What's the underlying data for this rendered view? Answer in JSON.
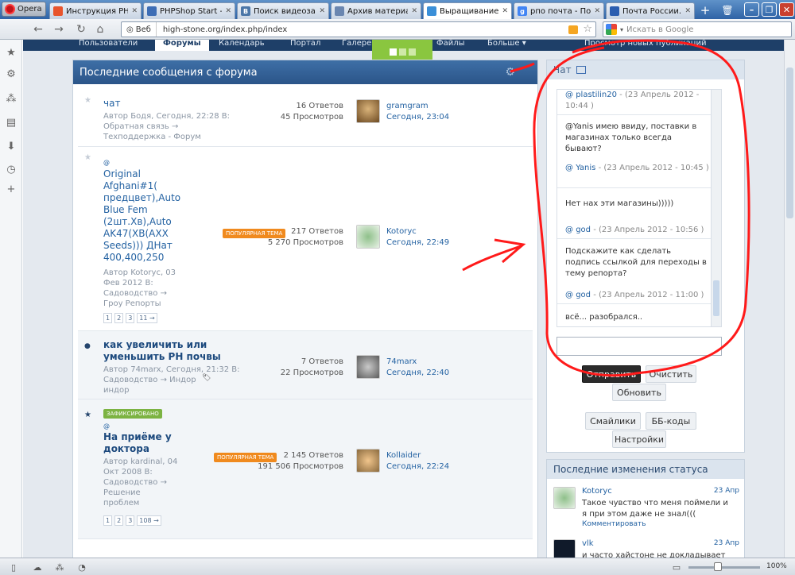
{
  "browser": {
    "menu_label": "Opera",
    "tabs": [
      {
        "label": "Инструкция PH...",
        "favicon": "opera-icon",
        "color": "#e8542c",
        "active": false
      },
      {
        "label": "PHPShop Start -...",
        "favicon": "phpshop-icon",
        "color": "#3d6db5",
        "active": false
      },
      {
        "label": "Поиск видеоза...",
        "favicon": "vk-icon",
        "color": "#4a76a8",
        "active": false
      },
      {
        "label": "Архив материа...",
        "favicon": "site-icon",
        "color": "#6a86b0",
        "active": false
      },
      {
        "label": "Выращивание к...",
        "favicon": "site-icon",
        "color": "#3a8fd8",
        "active": true
      },
      {
        "label": "рпо почта - Пои...",
        "favicon": "google-icon",
        "color": "#4285f4",
        "active": false
      },
      {
        "label": "Почта России. ...",
        "favicon": "mail-icon",
        "color": "#2a5db0",
        "active": false
      }
    ],
    "address": {
      "badge": "Веб",
      "url": "high-stone.org/index.php/index"
    },
    "search": {
      "placeholder": "Искать в Google"
    },
    "zoom": "100%"
  },
  "site_nav": {
    "items": [
      "Пользователи",
      "Форумы",
      "Календарь",
      "Портал",
      "Галерея",
      "Файлы",
      "Больше ▾",
      "Просмотр новых публикаций"
    ],
    "active": "Форумы"
  },
  "forum": {
    "title": "Последние сообщения с форума",
    "topics": [
      {
        "title": "чат",
        "meta": [
          "Автор Бодя, Сегодня, 22:28 В:",
          "Обратная связь →",
          "Техподдержка - Форум"
        ],
        "badge": "",
        "pages": [],
        "replies": "16 Ответов",
        "views": "45 Просмотров",
        "last_user": "gramgram",
        "last_time": "Сегодня, 23:04"
      },
      {
        "title": "Original Afghani#1(предцвет),Auto Blue Fem (2шт.Xв),Auto AK47(XB(AXX Seeds))) ДНат 400,400,250",
        "title_lines": [
          "Original",
          "Afghani#1(",
          "предцвет),Auto",
          "Blue Fem",
          "(2шт.Xв),Auto",
          "AK47(XB(AXX",
          "Seeds))) ДНат",
          "400,400,250"
        ],
        "meta": [
          "Автор Kotoryc, 03",
          "Фев 2012 В:",
          "Садоводство →",
          "Гроу Репорты"
        ],
        "badge": "ПОПУЛЯРНАЯ ТЕМА",
        "pages": [
          "1",
          "2",
          "3",
          "11 →"
        ],
        "replies": "217 Ответов",
        "views": "5 270 Просмотров",
        "last_user": "Kotoryc",
        "last_time": "Сегодня, 22:49"
      },
      {
        "title": "как увеличить или уменьшить PH почвы",
        "title_lines": [
          "как увеличить или",
          "уменьшить PH почвы"
        ],
        "meta": [
          "Автор 74marx, Сегодня, 21:32 В:",
          "Садоводство → Индор",
          "индор"
        ],
        "badge": "",
        "pages": [],
        "replies": "7 Ответов",
        "views": "22 Просмотров",
        "last_user": "74marx",
        "last_time": "Сегодня, 22:40"
      },
      {
        "title": "На приёме у доктора",
        "title_lines": [
          "На приёме у",
          "доктора"
        ],
        "pinned_label": "ЗАФИКСИРОВАНО",
        "meta": [
          "Автор kardinal, 04",
          "Окт 2008 В:",
          "Садоводство →",
          "Решение",
          "проблем"
        ],
        "badge": "ПОПУЛЯРНАЯ ТЕМА",
        "pages": [
          "1",
          "2",
          "3",
          "108 →"
        ],
        "replies": "2 145 Ответов",
        "views": "191 506 Просмотров",
        "last_user": "Kollaider",
        "last_time": "Сегодня, 22:24"
      }
    ]
  },
  "chat": {
    "title": "Чат",
    "messages": [
      {
        "user": "plastilin20",
        "time": "- (23 Апрель 2012 - 10:44 )",
        "text": "@Yanis имею ввиду, поставки в магазинах только всегда бывают?"
      },
      {
        "user": "Yanis",
        "time": "- (23 Апрель 2012 - 10:45 )",
        "text": "Нет нах эти магазины)))))"
      },
      {
        "user": "god",
        "time": "- (23 Апрель 2012 - 10:56 )",
        "text": "Подскажите как сделать подпись ссылкой для переходы в тему репорта?"
      },
      {
        "user": "god",
        "time": "- (23 Апрель 2012 - 11:00 )",
        "text": "всё... разобрался.."
      }
    ],
    "buttons": {
      "send": "Отправить",
      "clear": "Очистить",
      "refresh": "Обновить",
      "smileys": "Смайлики",
      "bbcodes": "ББ-коды",
      "settings": "Настройки"
    }
  },
  "status_updates": {
    "title": "Последние изменения статуса",
    "items": [
      {
        "user": "Kotoryc",
        "date": "23 Апр",
        "text": "Такое чувство что меня поймели и я при этом даже не знал(((",
        "link": "Комментировать"
      },
      {
        "user": "vlk",
        "date": "23 Апр",
        "text": "и часто хайстоне не докладывает"
      }
    ]
  },
  "colors": {
    "annotation": "#ff1a1a",
    "header_blue": "#2b5589",
    "popular": "#f08a1e",
    "pinned": "#7cb342"
  }
}
